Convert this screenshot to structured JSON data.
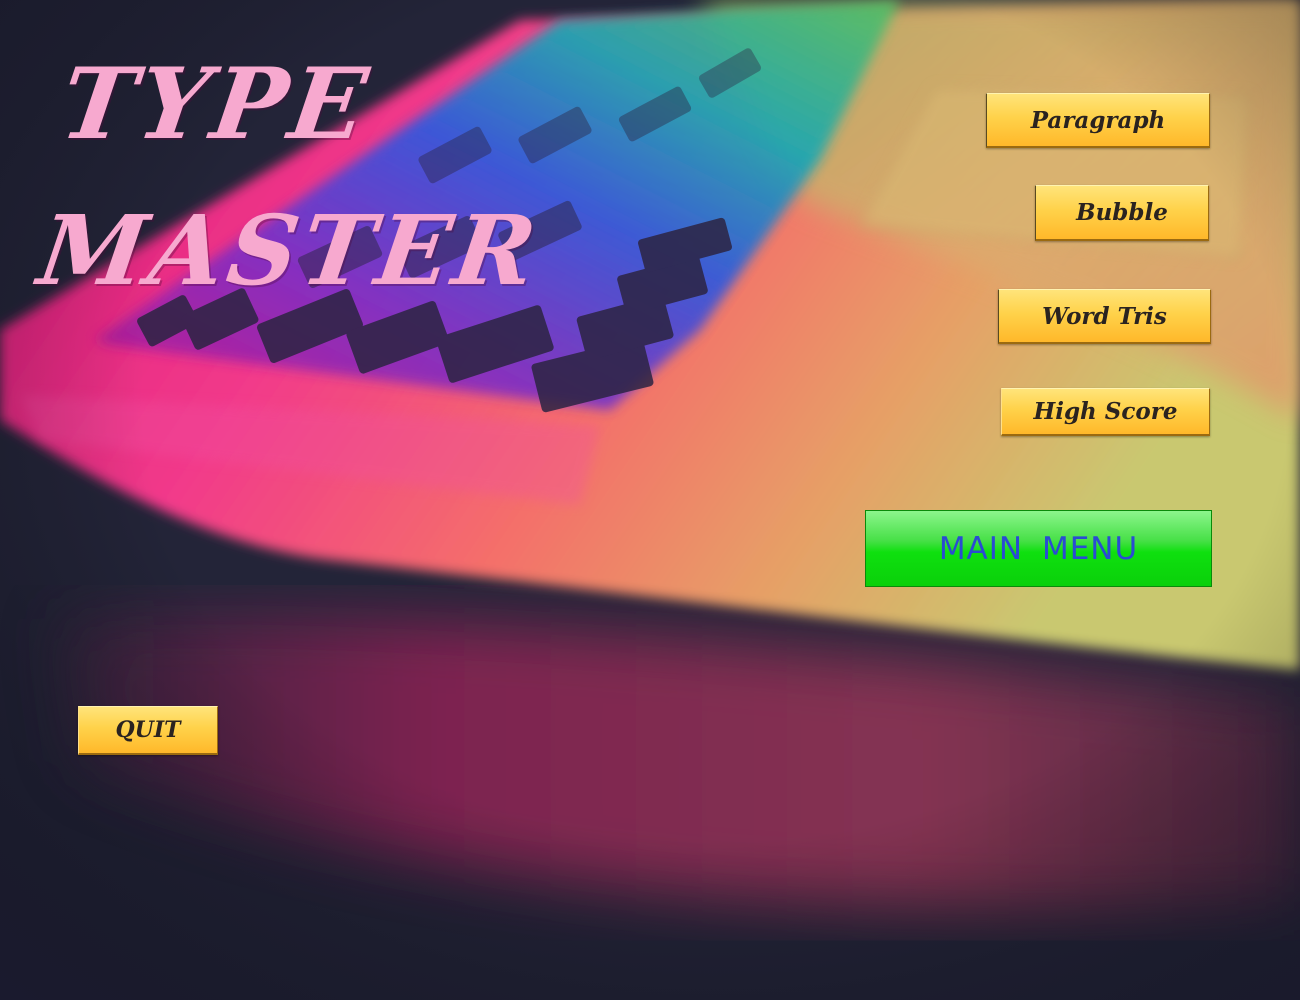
{
  "title": {
    "line1": "TYPE",
    "line2": "MASTER"
  },
  "menu": {
    "paragraph_label": "Paragraph",
    "bubble_label": "Bubble",
    "word_tris_label": "Word Tris",
    "high_score_label": "High Score",
    "main_menu_label": "MAIN  MENU",
    "quit_label": "QUIT"
  },
  "colors": {
    "title": "#f7a9cf",
    "gold_button": "#ffd24a",
    "main_menu_button": "#0fe00f",
    "main_menu_text": "#2a4cd2",
    "background_dark": "#232438"
  },
  "background": {
    "description_icon": "rgb-laptop-keyboard-background"
  }
}
